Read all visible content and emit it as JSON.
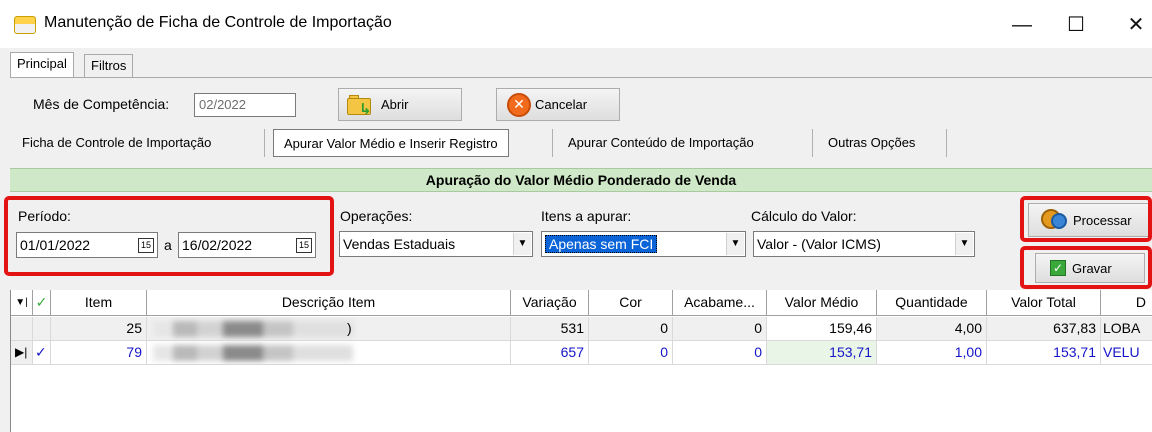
{
  "window": {
    "title": "Manutenção de Ficha de Controle de Importação",
    "minimize": "—",
    "maximize": "☐",
    "close": "✕"
  },
  "tabs": {
    "principal": "Principal",
    "filtros": "Filtros"
  },
  "mes": {
    "label": "Mês de Competência:",
    "value": "02/2022"
  },
  "buttons": {
    "abrir": "Abrir",
    "cancelar": "Cancelar",
    "processar": "Processar",
    "gravar": "Gravar"
  },
  "subtabs": {
    "ficha": "Ficha de Controle de Importação",
    "apurar_valor": "Apurar Valor Médio e Inserir Registro",
    "apurar_conteudo": "Apurar Conteúdo de Importação",
    "outras": "Outras Opções"
  },
  "section_title": "Apuração do Valor Médio Ponderado de Venda",
  "periodo": {
    "label": "Período:",
    "from": "01/01/2022",
    "sep": "a",
    "to": "16/02/2022",
    "cal": "15"
  },
  "operacoes": {
    "label": "Operações:",
    "value": "Vendas Estaduais"
  },
  "itens": {
    "label": "Itens a apurar:",
    "value": "Apenas sem FCI"
  },
  "calculo": {
    "label": "Cálculo do Valor:",
    "value": "Valor - (Valor ICMS)"
  },
  "grid": {
    "headers": {
      "check": "✓",
      "item": "Item",
      "descricao": "Descrição Item",
      "variacao": "Variação",
      "cor": "Cor",
      "acabamento": "Acabame...",
      "valor_medio": "Valor Médio",
      "quantidade": "Quantidade",
      "valor_total": "Valor Total",
      "d": "D"
    },
    "rows": [
      {
        "item": "25",
        "descricao": ")",
        "variacao": "531",
        "cor": "0",
        "acabamento": "0",
        "valor_medio": "159,46",
        "quantidade": "4,00",
        "valor_total": "637,83",
        "d": "LOBA"
      },
      {
        "check": "✓",
        "item": "79",
        "descricao": "",
        "variacao": "657",
        "cor": "0",
        "acabamento": "0",
        "valor_medio": "153,71",
        "quantidade": "1,00",
        "valor_total": "153,71",
        "d": "VELU"
      }
    ]
  },
  "colors": {
    "section_bg": "#cfe8c7",
    "highlight": "#e31313",
    "selection": "#0a64d8",
    "row_selected_text": "#1515c8"
  }
}
